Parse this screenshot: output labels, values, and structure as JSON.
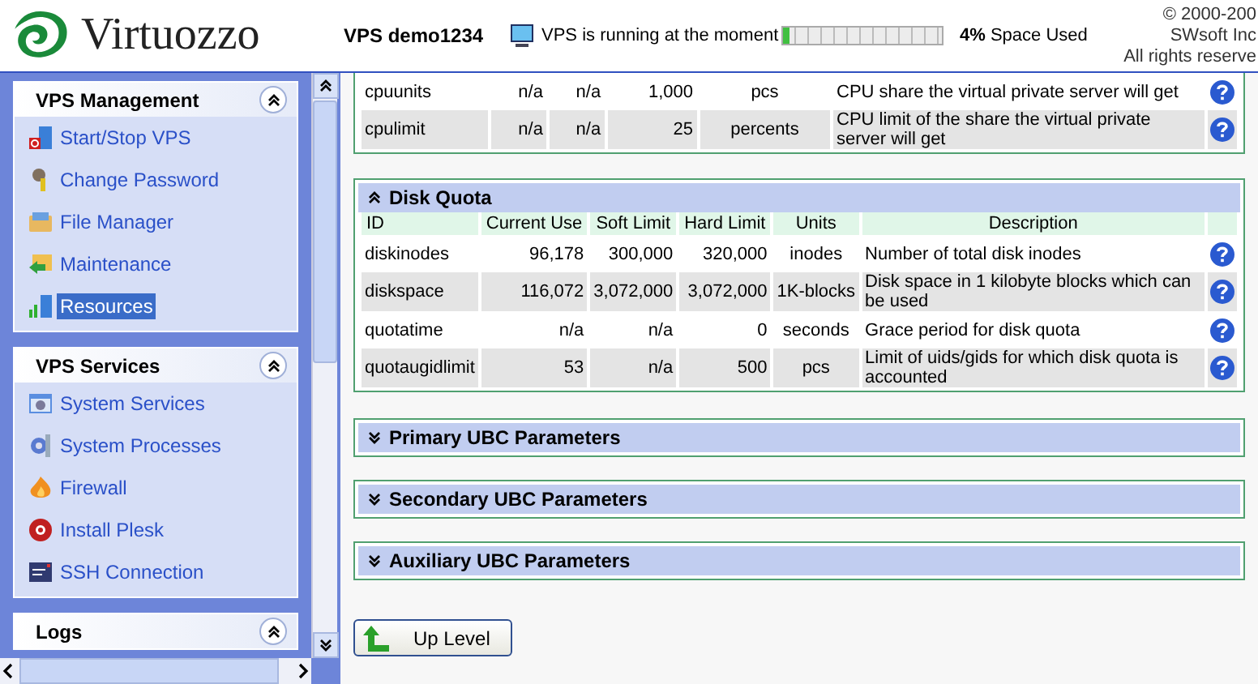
{
  "header": {
    "logo_text": "Virtuozzo",
    "vps_name": "VPS demo1234",
    "status_text": "VPS is running at the moment",
    "space": {
      "level": 0.04,
      "percent": "4%",
      "label": "Space Used"
    },
    "copyright": [
      "© 2000-200",
      "SWsoft Inc",
      "All rights reserve"
    ]
  },
  "sidebar": {
    "sections": [
      {
        "title": "VPS Management",
        "expanded": true,
        "items": [
          {
            "label": "Start/Stop VPS",
            "selected": false
          },
          {
            "label": "Change Password",
            "selected": false
          },
          {
            "label": "File Manager",
            "selected": false
          },
          {
            "label": "Maintenance",
            "selected": false
          },
          {
            "label": "Resources",
            "selected": true
          }
        ]
      },
      {
        "title": "VPS Services",
        "expanded": true,
        "items": [
          {
            "label": "System Services",
            "selected": false
          },
          {
            "label": "System Processes",
            "selected": false
          },
          {
            "label": "Firewall",
            "selected": false
          },
          {
            "label": "Install Plesk",
            "selected": false
          },
          {
            "label": "SSH Connection",
            "selected": false
          }
        ]
      },
      {
        "title": "Logs",
        "expanded": true
      }
    ]
  },
  "content": {
    "cpu_table": {
      "rows": [
        [
          "cpuunits",
          "n/a",
          "n/a",
          "1,000",
          "pcs",
          "CPU share the virtual private server will get"
        ],
        [
          "cpulimit",
          "n/a",
          "n/a",
          "25",
          "percents",
          "CPU limit of the share the virtual private server will get"
        ]
      ]
    },
    "panels": [
      {
        "title": "Disk Quota",
        "expanded": true,
        "columns": [
          "ID",
          "Current Use",
          "Soft Limit",
          "Hard Limit",
          "Units",
          "Description"
        ],
        "rows": [
          [
            "diskinodes",
            "96,178",
            "300,000",
            "320,000",
            "inodes",
            "Number of total disk inodes"
          ],
          [
            "diskspace",
            "116,072",
            "3,072,000",
            "3,072,000",
            "1K-blocks",
            "Disk space in 1 kilobyte blocks which can be used"
          ],
          [
            "quotatime",
            "n/a",
            "n/a",
            "0",
            "seconds",
            "Grace period for disk quota"
          ],
          [
            "quotaugidlimit",
            "53",
            "n/a",
            "500",
            "pcs",
            "Limit of uids/gids for which disk quota is accounted"
          ]
        ]
      },
      {
        "title": "Primary UBC Parameters",
        "expanded": false
      },
      {
        "title": "Secondary UBC Parameters",
        "expanded": false
      },
      {
        "title": "Auxiliary UBC Parameters",
        "expanded": false
      }
    ],
    "up_button": "Up Level"
  }
}
